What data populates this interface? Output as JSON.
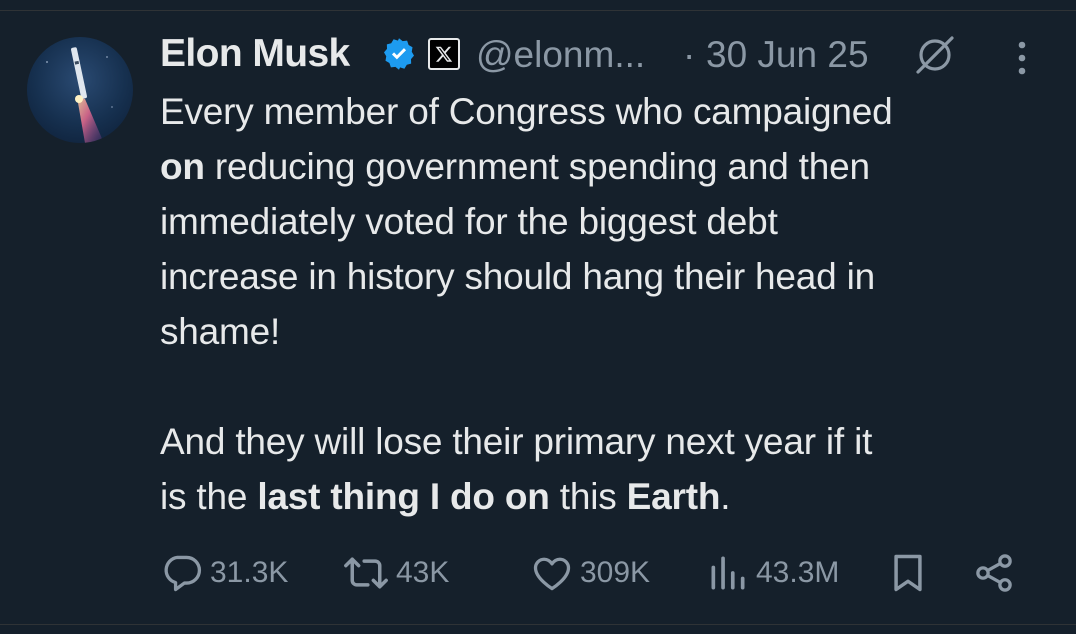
{
  "author": {
    "name": "Elon Musk",
    "handle": "@elonm...",
    "date_separator": "·",
    "date": "30 Jun 25"
  },
  "tweet": {
    "line1": "Every member of Congress who campaigned",
    "line2_bold": "on",
    "line2_rest": " reducing government spending and then",
    "line3": "immediately voted for the biggest debt",
    "line4": "increase in history should hang their head in",
    "line5": "shame!",
    "line6": "And they will lose their primary next year if it",
    "line7_pre": "is the ",
    "line7_bold1": "last thing I do on",
    "line7_mid": " this ",
    "line7_bold2": "Earth",
    "line7_end": "."
  },
  "actions": {
    "replies": "31.3K",
    "reposts": "43K",
    "likes": "309K",
    "views": "43.3M"
  },
  "icons": {
    "verified": "verified-badge-icon",
    "affiliate": "x-logo-icon",
    "grok": "grok-icon",
    "more": "more-icon",
    "reply": "reply-icon",
    "repost": "repost-icon",
    "like": "like-icon",
    "views": "views-icon",
    "bookmark": "bookmark-icon",
    "share": "share-icon"
  },
  "colors": {
    "background": "#15202b",
    "text": "#e7e9ea",
    "secondary": "#8b98a5",
    "verified": "#1d9bf0"
  }
}
